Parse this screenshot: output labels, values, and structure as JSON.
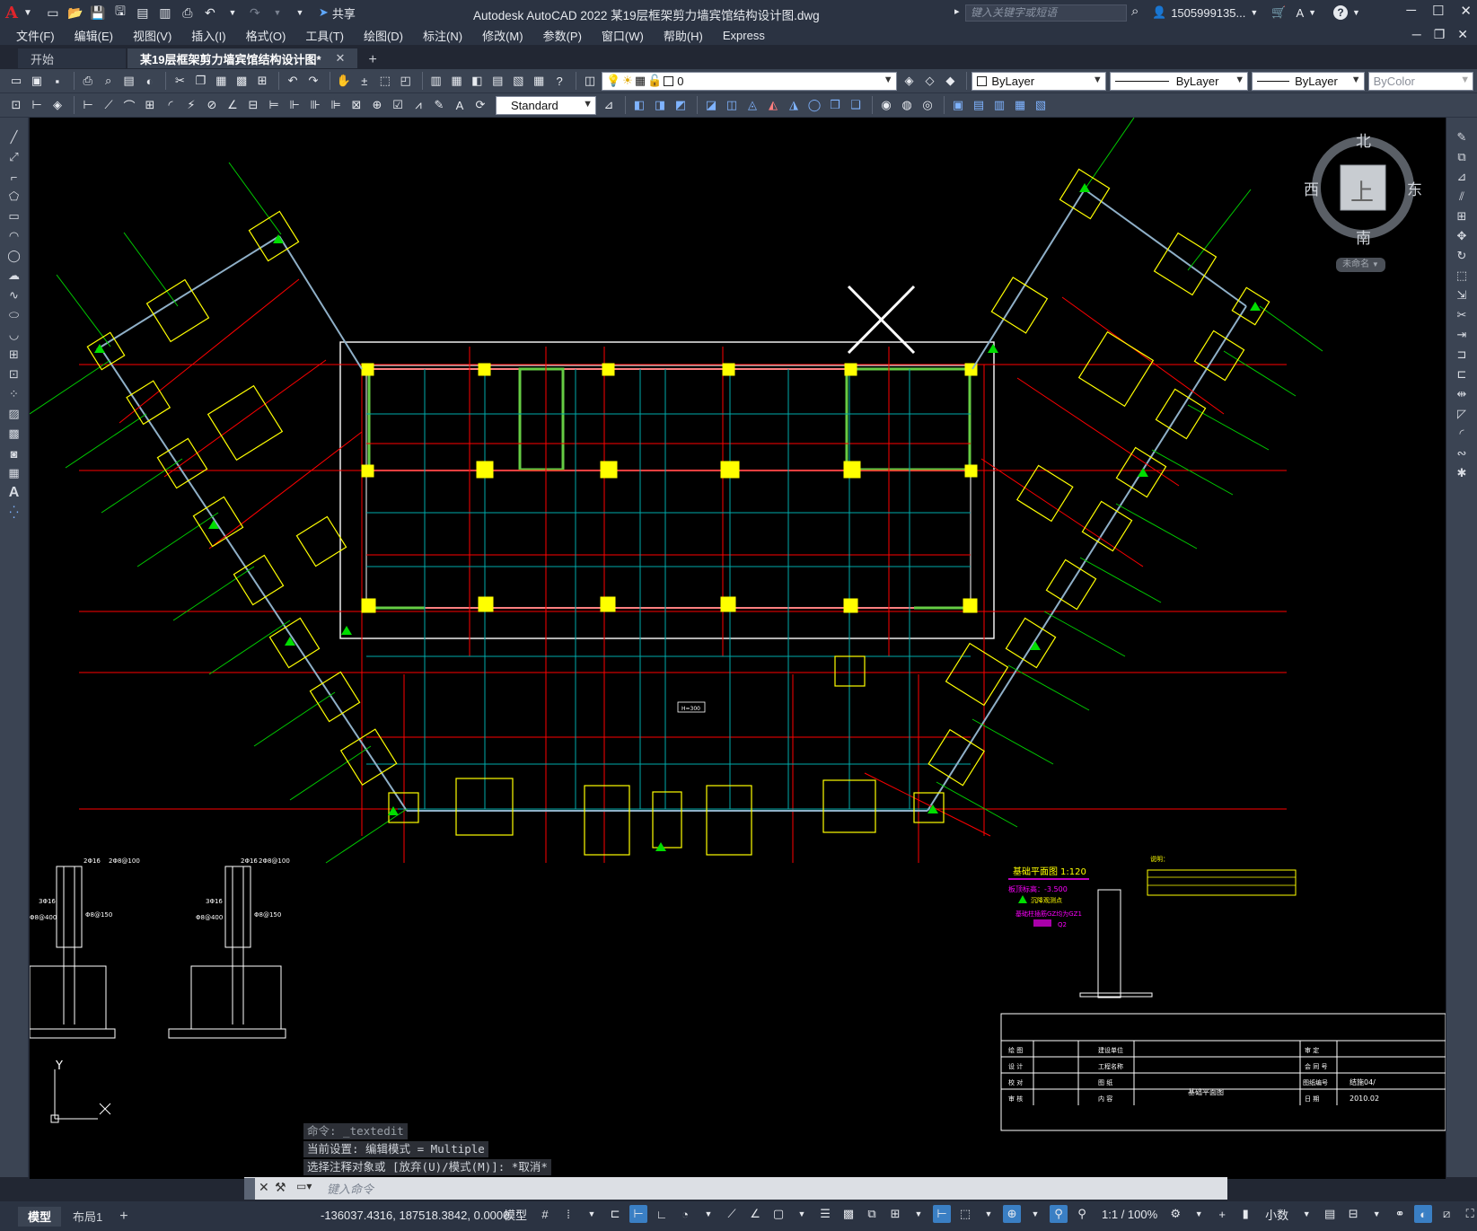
{
  "title_bar": {
    "app_logo": "A",
    "share_label": "共享",
    "window_title": "Autodesk AutoCAD 2022    某19层框架剪力墙宾馆结构设计图.dwg",
    "search_placeholder": "键入关键字或短语",
    "user_name": "1505999135..."
  },
  "menu": [
    "文件(F)",
    "编辑(E)",
    "视图(V)",
    "插入(I)",
    "格式(O)",
    "工具(T)",
    "绘图(D)",
    "标注(N)",
    "修改(M)",
    "参数(P)",
    "窗口(W)",
    "帮助(H)",
    "Express"
  ],
  "tabs": [
    {
      "label": "开始"
    },
    {
      "label": "某19层框架剪力墙宾馆结构设计图*"
    }
  ],
  "layer_combo": {
    "value": "0"
  },
  "color_combo": {
    "value": "ByLayer"
  },
  "linetype_combo": {
    "value": "ByLayer"
  },
  "lineweight_combo": {
    "value": "ByLayer"
  },
  "plotstyle_combo": {
    "value": "ByColor"
  },
  "textstyle_combo": {
    "value": "Standard"
  },
  "viewcube": {
    "north": "北",
    "south": "南",
    "east": "东",
    "west": "西",
    "face": "上",
    "ucs": "未命名"
  },
  "drawing": {
    "plan_title": "基础平面图",
    "plan_scale": "1:120",
    "elevation_note": "板顶标高：-3.500",
    "legend_1": "沉降观测点",
    "legend_2": "基础柱插筋GZ均为GZ1",
    "legend_3": "Q2",
    "beam_label": "H=300",
    "notes_title": "说明：",
    "title_block": {
      "row1": [
        "绘 图",
        "建设单位",
        "审 定"
      ],
      "row2": [
        "设 计",
        "工程名称",
        "会 同 号"
      ],
      "row3": [
        "校 对",
        "图 纸",
        "图纸编号",
        "结施04/"
      ],
      "row4": [
        "审 核",
        "内 容",
        "基础平面图",
        "日 期",
        "2010.02"
      ]
    },
    "detail_label_1": "2Φ16",
    "detail_label_2": "2Φ8@100",
    "detail_label_3": "3Φ16",
    "detail_label_4": "Φ8@400",
    "detail_label_5": "Φ8@150",
    "ucs_note": "Y"
  },
  "command_history": [
    "命令: _textedit",
    "当前设置: 编辑模式 = Multiple",
    "选择注释对象或 [放弃(U)/模式(M)]: *取消*"
  ],
  "command_placeholder": "键入命令",
  "status": {
    "model_tab": "模型",
    "layout_tab": "布局1",
    "coordinates": "-136037.4316, 187518.3842, 0.0000",
    "model_space": "模型",
    "scale": "1:1 / 100%",
    "units": "小数"
  },
  "colors": {
    "canvas": "#000000",
    "ui_dark": "#2b3342",
    "ui_mid": "#3b4453",
    "beam_red": "#ff0000",
    "grid_cyan": "#00cccc",
    "column_yellow": "#ffff00",
    "green": "#00cc00"
  }
}
